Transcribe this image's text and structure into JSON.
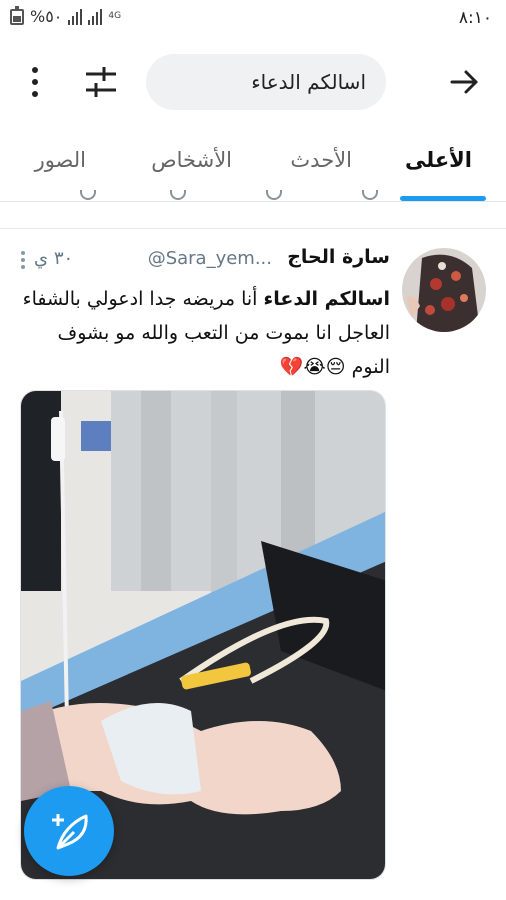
{
  "status_bar": {
    "time": "٨:١٠",
    "battery": "%٥٠",
    "network": "4G"
  },
  "search": {
    "query": "اسالكم الدعاء"
  },
  "tabs": [
    {
      "label": "الأعلى",
      "active": true
    },
    {
      "label": "الأحدث",
      "active": false
    },
    {
      "label": "الأشخاص",
      "active": false
    },
    {
      "label": "الصور",
      "active": false
    }
  ],
  "tweet": {
    "author_name": "سارة الحاج",
    "handle": "@Sara_yem...",
    "time": "٣٠ ي",
    "text_highlight": "اسالكم الدعاء",
    "text_rest": " أنا  مريضه جدا ادعولي بالشفاء العاجل انا بموت من التعب والله مو بشوف النوم",
    "emojis": "😔😭💔"
  },
  "colors": {
    "accent": "#1d9bf0",
    "search_bg": "#eff1f3",
    "muted_text": "#657786"
  },
  "icons": {
    "back": "arrow-right-icon",
    "filter": "sliders-icon",
    "more": "vertical-dots-icon",
    "compose": "feather-plus-icon"
  }
}
